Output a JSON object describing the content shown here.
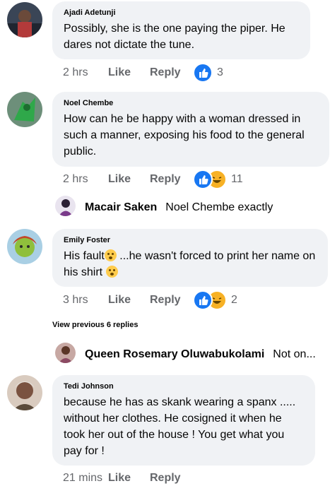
{
  "comments": [
    {
      "author": "Ajadi Adetunji",
      "text": "Possibly, she is the one paying the piper. He dares not dictate the tune.",
      "time": "2 hrs",
      "like": "Like",
      "reply": "Reply",
      "reactions": "3",
      "reaction_icons": [
        "like-icon"
      ]
    },
    {
      "author": "Noel Chembe",
      "text": "How can he be happy with a woman dressed in such a manner, exposing his food to the general public.",
      "time": "2 hrs",
      "like": "Like",
      "reply": "Reply",
      "reactions": "11",
      "reaction_icons": [
        "like-icon",
        "haha-icon"
      ]
    },
    {
      "author": "Emily Foster",
      "text_part1": "His fault",
      "text_part2": " ...he wasn't forced to print her name on his shirt ",
      "time": "3 hrs",
      "like": "Like",
      "reply": "Reply",
      "reactions": "2",
      "reaction_icons": [
        "like-icon",
        "haha-icon"
      ]
    },
    {
      "author": "Tedi Johnson",
      "text": "because he has as skank wearing a spanx ..... without her clothes.  He cosigned it when he took her out of the house !  You get what you pay for !",
      "time": "21 mins",
      "like": "Like",
      "reply": "Reply"
    }
  ],
  "replies": [
    {
      "author": "Macair Saken",
      "preview": "Noel Chembe  exactly"
    },
    {
      "author": "Queen Rosemary Oluwabukolami",
      "preview": "Not on..."
    }
  ],
  "view_previous": "View previous 6 replies",
  "colors": {
    "bubble": "#f0f2f5",
    "meta_text": "#65676b",
    "like_blue": "#1877f2",
    "haha_yellow": "#f7b125"
  }
}
